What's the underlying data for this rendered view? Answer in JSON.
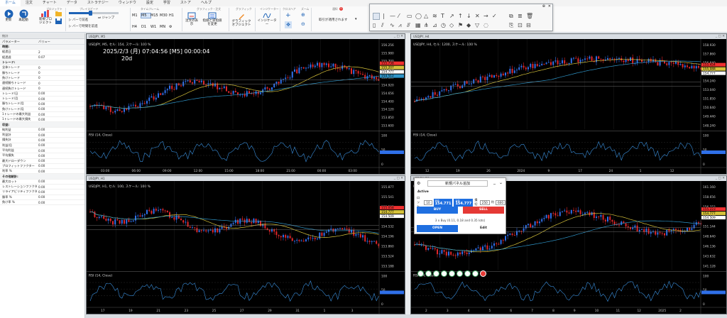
{
  "menu": [
    "ホーム",
    "注文",
    "チャート",
    "データ",
    "ストラテジー",
    "ウィンドウ",
    "設定",
    "学習",
    "ストア",
    "ヘルプ"
  ],
  "menu_active": 0,
  "ribbon": {
    "update": "更新",
    "replay": "再起動",
    "new_project": "新規プロジェクト",
    "project_group": "プロジェクト",
    "play_speed": "プレイスピード",
    "bar_step": "バーで前進",
    "jump": "ジャンプ",
    "bar_time_step": "バーで時間を前進",
    "timeframes_row1": [
      "M1",
      "M5",
      "M15",
      "M30",
      "H1"
    ],
    "timeframes_row2": [
      "H4",
      "D1",
      "W1",
      "MN"
    ],
    "timeframe_active": "M5",
    "timeframe_group": "タイムフレーム",
    "show_orders": "注文の表示",
    "change_order": "指値と逆指値を変更",
    "order_group": "グラフィック・注文",
    "graphic_objects": "グラフィックオブジェクト",
    "graphic_group": "グラフィック",
    "indicator": "インジケーター",
    "indicator_sub": "インジケーター",
    "indicator_group": "インジケーター",
    "crosshair_group": "クロスヘア",
    "zoom_group": "ズーム",
    "notice": "通知",
    "notice_count": "0",
    "apply_label": "取引が適用されます"
  },
  "left_panel": {
    "title": "統計",
    "col_param": "パラメーター",
    "col_value": "バリュー",
    "rows": [
      {
        "k": "時間:",
        "v": "",
        "sec": true
      },
      {
        "k": "経過日",
        "v": "2"
      },
      {
        "k": "経過週",
        "v": "0.07"
      },
      {
        "k": "トレード:",
        "v": "",
        "sec": true
      },
      {
        "k": "全体トレード",
        "v": "0"
      },
      {
        "k": "勝ちトレード",
        "v": "0"
      },
      {
        "k": "負けトレード",
        "v": "0"
      },
      {
        "k": "連続勝ちトレード",
        "v": "0"
      },
      {
        "k": "連続負けトレード",
        "v": "0"
      },
      {
        "k": "トレード/日",
        "v": "0.00"
      },
      {
        "k": "トレード/月",
        "v": "0.00"
      },
      {
        "k": "勝ちトレード/月",
        "v": "0.00"
      },
      {
        "k": "負けトレード/月",
        "v": "0.00"
      },
      {
        "k": "1トレードの最大利益",
        "v": "0.00"
      },
      {
        "k": "1トレードの最大損失",
        "v": "0.00"
      },
      {
        "k": "収益:",
        "v": "",
        "sec": true
      },
      {
        "k": "純利益",
        "v": "0.00"
      },
      {
        "k": "利益計",
        "v": "0.00"
      },
      {
        "k": "損失計",
        "v": "0.00"
      },
      {
        "k": "利益/月",
        "v": "0.00"
      },
      {
        "k": "平均利益",
        "v": "0.00"
      },
      {
        "k": "平均損失",
        "v": "0.00"
      },
      {
        "k": "最大ドローダウン",
        "v": "0.00"
      },
      {
        "k": "プロフィットファクター",
        "v": "0.00"
      },
      {
        "k": "利率 %",
        "v": "0.00"
      },
      {
        "k": "その他統計:",
        "v": "",
        "sec": true
      },
      {
        "k": "最大ロット",
        "v": "0.00"
      },
      {
        "k": "レストレーションファクター",
        "v": "0.00"
      },
      {
        "k": "リライアビリティファクター",
        "v": "0.00"
      },
      {
        "k": "勝率 %",
        "v": "0.00"
      },
      {
        "k": "負け率 %",
        "v": "0.00"
      }
    ]
  },
  "charts": [
    {
      "title": "USDJPY, M5",
      "legend": "USDJPY, M5, セル: 154, スケール: 100 %",
      "overlay_datetime": "2025/2/3 (月) 07:04:56 [M5] 00:00:04",
      "overlay_period": "20d",
      "rsi": "RSI (14, Close)",
      "prices": [
        "156.256",
        "155.980",
        "155.700",
        "155.470",
        "155.180",
        "154.920",
        "154.656",
        "154.400",
        "154.120",
        "153.850",
        "153.600"
      ],
      "tags": [
        "155.738",
        "155.207",
        "154.777",
        "154.512"
      ],
      "rsi_scale": [
        "100",
        "50",
        "0"
      ],
      "x_labels": [
        "03:00",
        "06:00",
        "09:00",
        "12:00",
        "15:00",
        "18:00",
        "21:00",
        "00:00",
        "03:00"
      ]
    },
    {
      "title": "USDJPY, H4",
      "legend": "USDJPY, H4, セル: 1200, スケール: 100 %",
      "rsi": "RSI (14, Close)",
      "prices": [
        "158.930",
        "157.860",
        "156.640",
        "155.440",
        "154.240",
        "153.040",
        "151.850",
        "150.640",
        "149.440",
        "148.240"
      ],
      "tags": [
        "155.454",
        "155.088",
        "154.777"
      ],
      "rsi_scale": [
        "100",
        "50",
        "0"
      ],
      "x_labels": [
        "12",
        "19",
        "26",
        "2024",
        "9",
        "17",
        "24",
        "1",
        "12"
      ]
    },
    {
      "title": "USDJPY, H1",
      "legend": "USDJPY, H1, セル: 100, スケール: 100 %",
      "rsi": "RSI (14, Close)",
      "prices": [
        "155.877",
        "155.541",
        "155.205",
        "154.868",
        "154.532",
        "154.196",
        "153.860",
        "153.524",
        "153.188"
      ],
      "tags": [
        "155.058",
        "154.777",
        "154.509"
      ],
      "rsi_scale": [
        "100",
        "50",
        "0"
      ],
      "x_labels": [
        "17",
        "19",
        "21",
        "23",
        "25",
        "27",
        "29",
        "31",
        "1",
        "3"
      ]
    },
    {
      "title": "USDJPY, D1",
      "legend": "USDJPY, D1, セル: 100, スケール: 100 %",
      "rsi": "RSI (14, Close)",
      "prices": [
        "161.160",
        "158.656",
        "156.152",
        "153.648",
        "151.144",
        "148.640",
        "146.136",
        "143.632",
        "141.128"
      ],
      "tags": [
        "155.223",
        "154.777",
        "154.509"
      ],
      "rsi_scale": [
        "100",
        "50",
        "0"
      ],
      "x_labels": [
        "2",
        "3",
        "4",
        "5",
        "6",
        "7",
        "8",
        "9",
        "10",
        "11",
        "12",
        "2025",
        "2"
      ]
    }
  ],
  "order_panel": {
    "title": "新規パネル追加",
    "status": "Active",
    "lot_label": "ロット",
    "lot_value": "10",
    "sell_label": "売値",
    "sell_price": "154.771",
    "buy_label": "買値",
    "buy_price": "154.777",
    "sl_label": "損切",
    "sl_value": "250",
    "tp_label": "利",
    "tp_value": "600",
    "buy": "BUY",
    "sell": "SELL",
    "info": "3 x Buy (0.11, 0.18 and 0.35 lots)",
    "open": "OPEN",
    "edit": "Edit"
  },
  "colors": {
    "accent": "#1e63b6",
    "bull": "#2f6fe8",
    "bear": "#e0262a",
    "ma1": "#d6c23a",
    "ma2": "#2f95c8",
    "price_tag": "#f03030"
  }
}
